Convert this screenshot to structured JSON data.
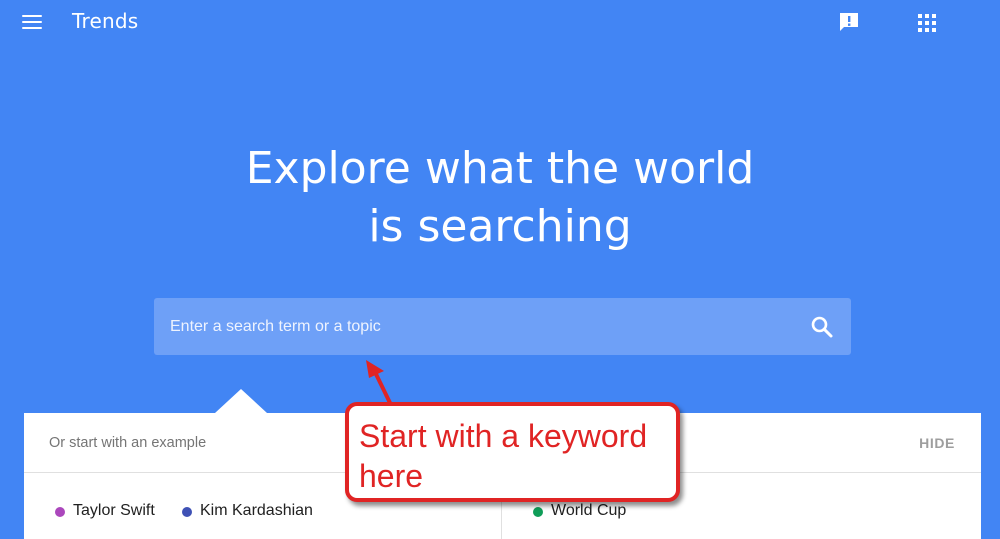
{
  "app": {
    "title": "Trends"
  },
  "header": {
    "menu_icon": "hamburger-menu-icon",
    "feedback_icon": "feedback-icon",
    "apps_icon": "apps-grid-icon"
  },
  "hero": {
    "title_line1": "Explore what the world",
    "title_line2": "is searching"
  },
  "search": {
    "placeholder": "Enter a search term or a topic",
    "value": "",
    "icon": "search-icon"
  },
  "examples": {
    "heading": "Or start with an example",
    "hide_label": "HIDE",
    "items": [
      {
        "label": "Taylor Swift",
        "color": "#ab47bc"
      },
      {
        "label": "Kim Kardashian",
        "color": "#3f51b5"
      },
      {
        "label": "World Cup",
        "color": "#0f9d58"
      }
    ]
  },
  "annotation": {
    "line1": "Start with a keyword",
    "line2": "here"
  },
  "colors": {
    "background": "#4285f4",
    "search_box": "#6ea0f7",
    "annotation_red": "#e02424"
  }
}
